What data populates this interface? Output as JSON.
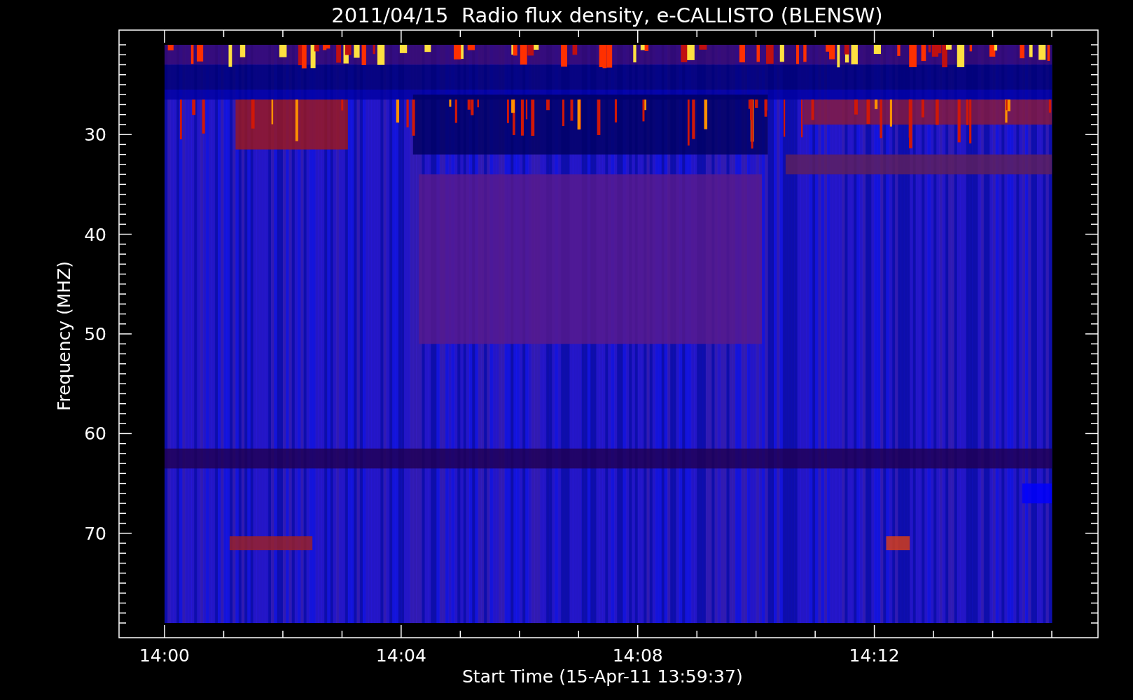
{
  "plot": {
    "title": "2011/04/15  Radio flux density, e-CALLISTO (BLENSW)",
    "xlabel": "Start Time (15-Apr-11 13:59:37)",
    "ylabel": "Frequency (MHZ)",
    "xticks": [
      "14:00",
      "14:04",
      "14:08",
      "14:12"
    ],
    "yticks": [
      "30",
      "40",
      "50",
      "60",
      "70"
    ]
  }
}
